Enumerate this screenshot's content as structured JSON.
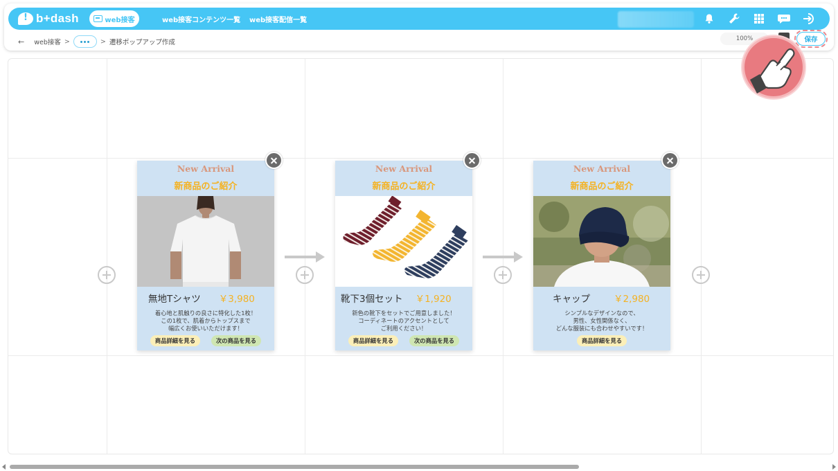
{
  "app": {
    "logo_text": "b+dash",
    "brand_color": "#46c6f5"
  },
  "nav": {
    "active_label": "web接客",
    "links": [
      "web接客コンテンツ一覧",
      "web接客配信一覧"
    ]
  },
  "top_icons": [
    "bell-icon",
    "wrench-icon",
    "grid-icon",
    "chat-icon",
    "logout-icon"
  ],
  "breadcrumb": {
    "back": "←",
    "root": "web接客",
    "sep": ">",
    "current": "遷移ポップアップ作成"
  },
  "toolbar": {
    "zoom": "100%",
    "save_label": "保存"
  },
  "cards": [
    {
      "header_en": "New Arrival",
      "header_jp": "新商品のご紹介",
      "name": "無地Tシャツ",
      "price": "￥3,980",
      "desc": "着心地と肌触りの良さに特化した1枚！\nこの1枚で、肌着からトップスまで\n幅広くお使いいただけます！",
      "btn_detail": "商品詳細を見る",
      "btn_next": "次の商品を見る",
      "image": "white-tshirt-photo"
    },
    {
      "header_en": "New Arrival",
      "header_jp": "新商品のご紹介",
      "name": "靴下3個セット",
      "price": "￥1,920",
      "desc": "新色の靴下をセットでご用意しました！\nコーディネートのアクセントとして\nご利用ください！",
      "btn_detail": "商品詳細を見る",
      "btn_next": "次の商品を見る",
      "image": "striped-socks-photo"
    },
    {
      "header_en": "New Arrival",
      "header_jp": "新商品のご紹介",
      "name": "キャップ",
      "price": "￥2,980",
      "desc": "シンプルなデザインなので、\n男性、女性関係なく、\nどんな服装にも合わせやすいです！",
      "btn_detail": "商品詳細を見る",
      "image": "navy-cap-photo"
    }
  ]
}
